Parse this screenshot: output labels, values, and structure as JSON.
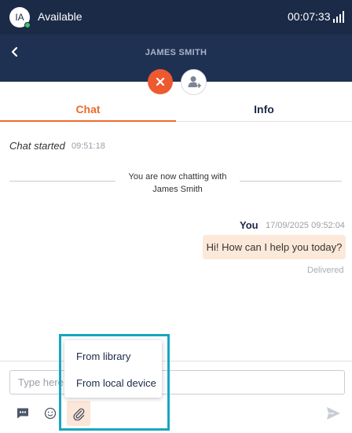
{
  "topbar": {
    "avatar_initials": "IA",
    "status": "Available",
    "timer": "00:07:33",
    "presence_color": "#3cc36b",
    "icons": [
      "signal-icon"
    ]
  },
  "header": {
    "contact_name": "JAMES SMITH",
    "icons": [
      "back-icon",
      "end-chat-icon",
      "transfer-icon"
    ]
  },
  "tabs": [
    {
      "label": "Chat",
      "active": true
    },
    {
      "label": "Info",
      "active": false
    }
  ],
  "chat": {
    "started_label": "Chat started",
    "started_time": "09:51:18",
    "system_line1": "You are now chatting with",
    "system_line2": "James Smith",
    "messages": [
      {
        "sender": "You",
        "timestamp": "17/09/2025 09:52:04",
        "text": "Hi! How can I help you today?",
        "status": "Delivered"
      }
    ]
  },
  "composer": {
    "placeholder": "Type here...",
    "tools": [
      "quick-replies-icon",
      "emoji-icon",
      "paperclip-icon",
      "send-icon"
    ]
  },
  "attach_menu": {
    "items": [
      {
        "label": "From library"
      },
      {
        "label": "From local device"
      }
    ]
  },
  "colors": {
    "topbar": "#1b2a47",
    "accent": "#ec6b2d",
    "end_call": "#ee5a2f",
    "bubble": "#fce9d9",
    "highlight": "#17a6bf"
  }
}
